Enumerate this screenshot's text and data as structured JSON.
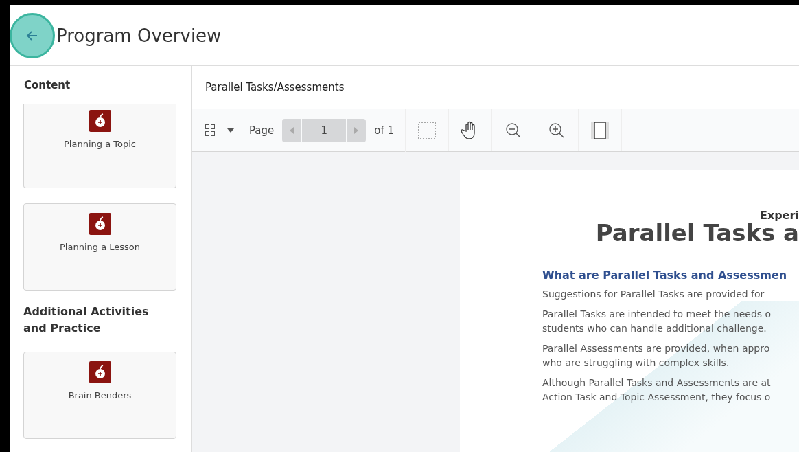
{
  "header": {
    "title": "Program Overview"
  },
  "sidebar": {
    "heading": "Content",
    "items": [
      {
        "kind": "card",
        "label": "Planning a Topic"
      },
      {
        "kind": "card",
        "label": "Planning a Lesson"
      },
      {
        "kind": "heading",
        "label": "Additional Activities and Practice"
      },
      {
        "kind": "card",
        "label": "Brain Benders"
      }
    ]
  },
  "viewer": {
    "title": "Parallel Tasks/Assessments",
    "toolbar": {
      "page_label": "Page",
      "page": "1",
      "of": "of 1",
      "single_page_selected": true
    },
    "document": {
      "kicker": "Experi",
      "title": "Parallel Tasks a",
      "subheading": "What are Parallel Tasks and Assessmen",
      "paragraphs": [
        "Suggestions for Parallel Tasks are provided for",
        "Parallel Tasks are intended to meet the needs o\nstudents who can handle additional challenge.",
        "Parallel Assessments are provided, when appro\nwho are struggling with complex skills.",
        "Although Parallel Tasks and Assessments are at\nAction Task and Topic Assessment, they focus o"
      ]
    }
  }
}
